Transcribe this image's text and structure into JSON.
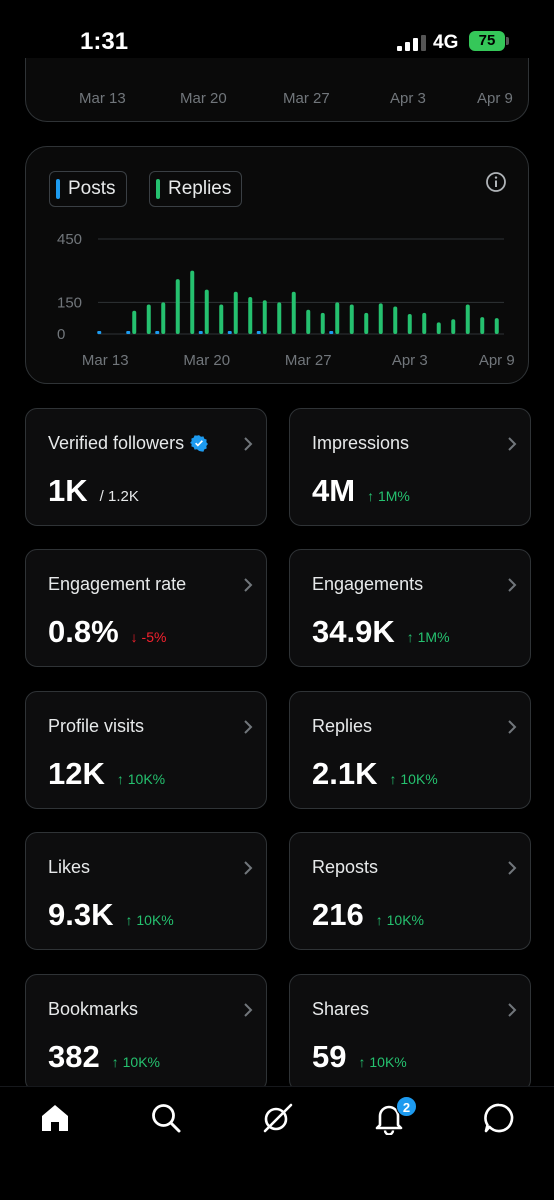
{
  "status_bar": {
    "time": "1:31",
    "network": "4G",
    "battery": "75"
  },
  "top_chart": {
    "x_ticks": [
      "Mar 13",
      "Mar 20",
      "Mar 27",
      "Apr 3",
      "Apr 9"
    ]
  },
  "chart_data": {
    "type": "bar",
    "title": "",
    "xlabel": "",
    "ylabel": "",
    "ylim": [
      0,
      450
    ],
    "y_ticks": [
      "450",
      "150",
      "0"
    ],
    "y_tick_values": [
      450,
      150,
      0
    ],
    "x_tick_labels": [
      "Mar 13",
      "Mar 20",
      "Mar 27",
      "Apr 3",
      "Apr 9"
    ],
    "x_tick_indices": [
      0,
      7,
      14,
      21,
      27
    ],
    "grid": true,
    "legend": "top-left",
    "categories": [
      "Mar 13",
      "Mar 14",
      "Mar 15",
      "Mar 16",
      "Mar 17",
      "Mar 18",
      "Mar 19",
      "Mar 20",
      "Mar 21",
      "Mar 22",
      "Mar 23",
      "Mar 24",
      "Mar 25",
      "Mar 26",
      "Mar 27",
      "Mar 28",
      "Mar 29",
      "Mar 30",
      "Mar 31",
      "Apr 1",
      "Apr 2",
      "Apr 3",
      "Apr 4",
      "Apr 5",
      "Apr 6",
      "Apr 7",
      "Apr 8",
      "Apr 9"
    ],
    "series": [
      {
        "name": "Posts",
        "color": "#1d9bf0",
        "values": [
          5,
          0,
          10,
          0,
          15,
          0,
          0,
          10,
          0,
          5,
          0,
          10,
          0,
          0,
          0,
          0,
          5,
          0,
          0,
          0,
          0,
          0,
          0,
          0,
          0,
          0,
          0,
          0
        ]
      },
      {
        "name": "Replies",
        "color": "#25c16f",
        "values": [
          0,
          0,
          110,
          140,
          150,
          260,
          300,
          210,
          140,
          200,
          175,
          160,
          150,
          200,
          115,
          100,
          150,
          140,
          100,
          145,
          130,
          95,
          100,
          55,
          70,
          140,
          80,
          75
        ]
      }
    ]
  },
  "legend": {
    "posts": "Posts",
    "replies": "Replies"
  },
  "metrics": [
    {
      "label": "Verified followers",
      "value": "1K",
      "sub": "/ 1.2K",
      "change": ""
    },
    {
      "label": "Impressions",
      "value": "4M",
      "sub": "",
      "change": "↑ 1M%"
    },
    {
      "label": "Engagement rate",
      "value": "0.8%",
      "sub": "",
      "change": "↓ -5%"
    },
    {
      "label": "Engagements",
      "value": "34.9K",
      "sub": "",
      "change": "↑ 1M%"
    },
    {
      "label": "Profile visits",
      "value": "12K",
      "sub": "",
      "change": "↑ 10K%"
    },
    {
      "label": "Replies",
      "value": "2.1K",
      "sub": "",
      "change": "↑ 10K%"
    },
    {
      "label": "Likes",
      "value": "9.3K",
      "sub": "",
      "change": "↑ 10K%"
    },
    {
      "label": "Reposts",
      "value": "216",
      "sub": "",
      "change": "↑ 10K%"
    },
    {
      "label": "Bookmarks",
      "value": "382",
      "sub": "",
      "change": "↑ 10K%"
    },
    {
      "label": "Shares",
      "value": "59",
      "sub": "",
      "change": "↑ 10K%"
    }
  ],
  "nav": {
    "notifications_badge": "2"
  },
  "icons": [
    "home-icon",
    "search-icon",
    "grok-icon",
    "bell-icon",
    "messages-icon",
    "info-icon",
    "chevron-right-icon",
    "verified-badge-icon"
  ]
}
